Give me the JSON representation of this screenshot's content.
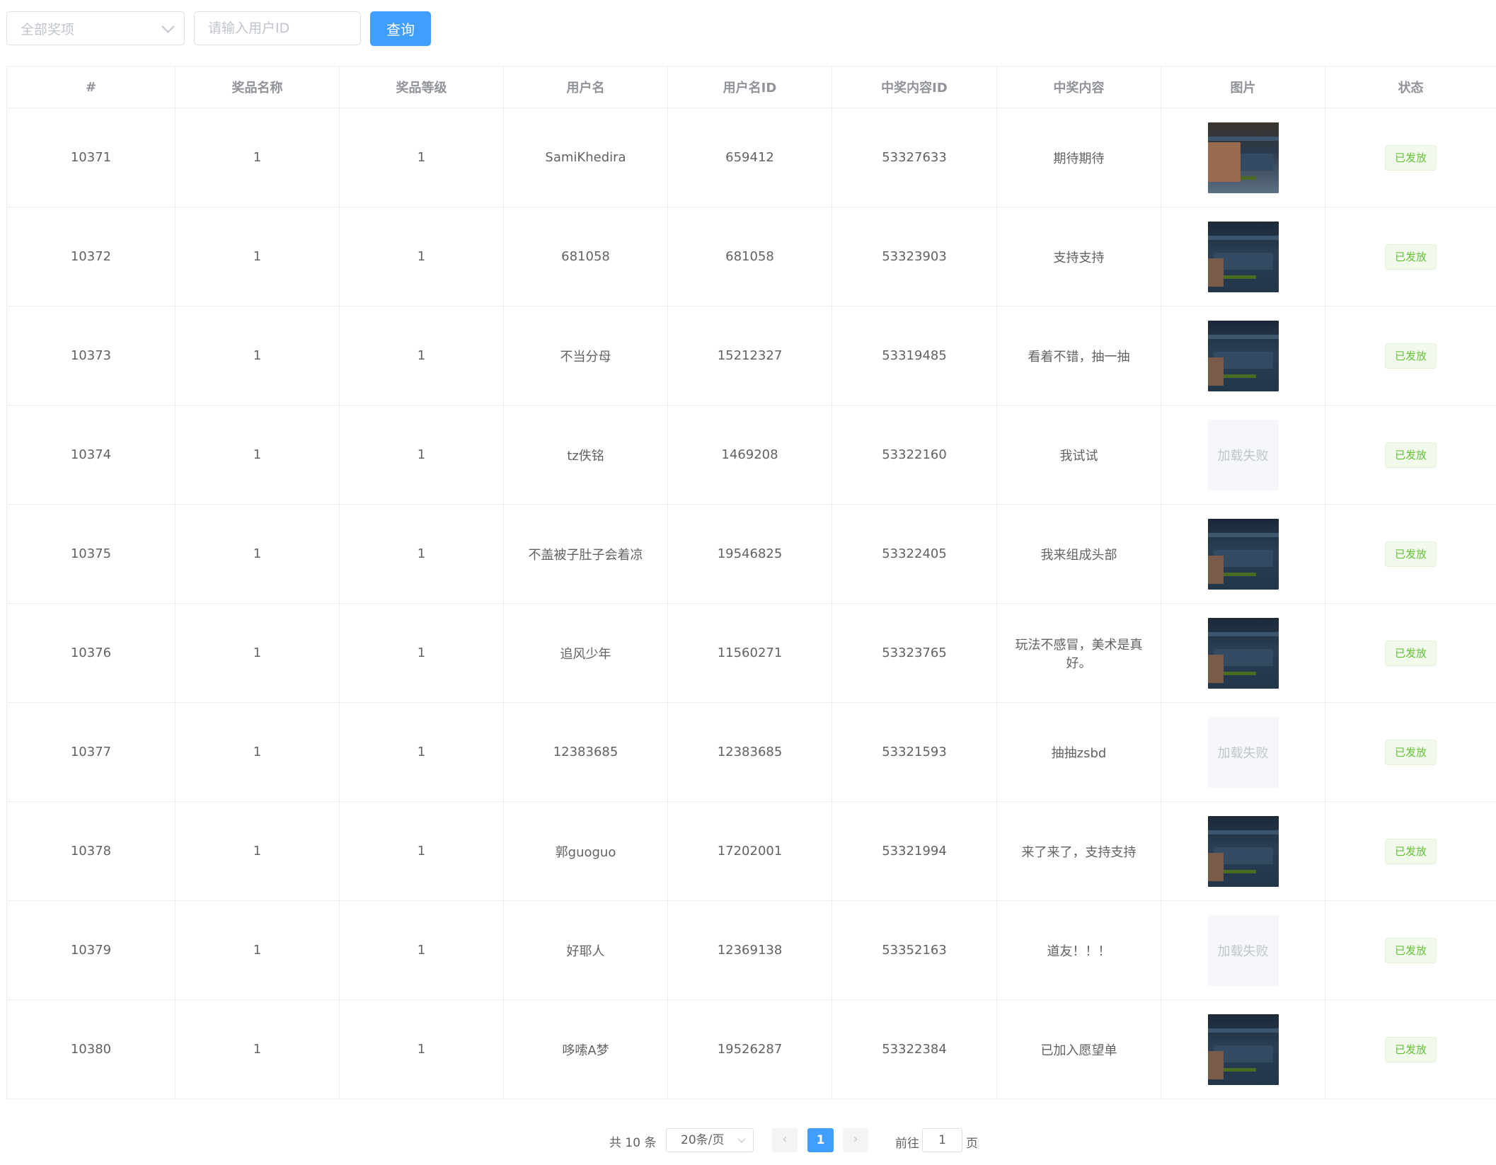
{
  "filters": {
    "prize_select_value": "全部奖项",
    "user_id_placeholder": "请输入用户ID",
    "query_button_label": "查询"
  },
  "table": {
    "columns": [
      "#",
      "奖品名称",
      "奖品等级",
      "用户名",
      "用户名ID",
      "中奖内容ID",
      "中奖内容",
      "图片",
      "状态"
    ],
    "image_fail_text": "加载失败",
    "rows": [
      {
        "id": "10371",
        "prize_name": "1",
        "prize_level": "1",
        "username": "SamiKhedira",
        "user_id": "659412",
        "content_id": "53327633",
        "content": "期待期待",
        "image_loaded": true,
        "status": "已发放"
      },
      {
        "id": "10372",
        "prize_name": "1",
        "prize_level": "1",
        "username": "681058",
        "user_id": "681058",
        "content_id": "53323903",
        "content": "支持支持",
        "image_loaded": true,
        "status": "已发放"
      },
      {
        "id": "10373",
        "prize_name": "1",
        "prize_level": "1",
        "username": "不当分母",
        "user_id": "15212327",
        "content_id": "53319485",
        "content": "看着不错，抽一抽",
        "image_loaded": true,
        "status": "已发放"
      },
      {
        "id": "10374",
        "prize_name": "1",
        "prize_level": "1",
        "username": "tz佚铭",
        "user_id": "1469208",
        "content_id": "53322160",
        "content": "我试试",
        "image_loaded": false,
        "status": "已发放"
      },
      {
        "id": "10375",
        "prize_name": "1",
        "prize_level": "1",
        "username": "不盖被子肚子会着凉",
        "user_id": "19546825",
        "content_id": "53322405",
        "content": "我来组成头部",
        "image_loaded": true,
        "status": "已发放"
      },
      {
        "id": "10376",
        "prize_name": "1",
        "prize_level": "1",
        "username": "追风少年",
        "user_id": "11560271",
        "content_id": "53323765",
        "content": "玩法不感冒，美术是真好。",
        "image_loaded": true,
        "status": "已发放"
      },
      {
        "id": "10377",
        "prize_name": "1",
        "prize_level": "1",
        "username": "12383685",
        "user_id": "12383685",
        "content_id": "53321593",
        "content": "抽抽zsbd",
        "image_loaded": false,
        "status": "已发放"
      },
      {
        "id": "10378",
        "prize_name": "1",
        "prize_level": "1",
        "username": "郭guoguo",
        "user_id": "17202001",
        "content_id": "53321994",
        "content": "来了来了，支持支持",
        "image_loaded": true,
        "status": "已发放"
      },
      {
        "id": "10379",
        "prize_name": "1",
        "prize_level": "1",
        "username": "好耶人",
        "user_id": "12369138",
        "content_id": "53352163",
        "content": "道友！！！",
        "image_loaded": false,
        "status": "已发放"
      },
      {
        "id": "10380",
        "prize_name": "1",
        "prize_level": "1",
        "username": "哆嗦A梦",
        "user_id": "19526287",
        "content_id": "53322384",
        "content": "已加入愿望单",
        "image_loaded": true,
        "status": "已发放"
      }
    ]
  },
  "pagination": {
    "total_text": "共 10 条",
    "page_size": "20条/页",
    "prev_icon": "chevron-left-icon",
    "next_icon": "chevron-right-icon",
    "current_page": "1",
    "goto_label": "前往",
    "goto_value": "1",
    "goto_unit": "页"
  },
  "colors": {
    "primary": "#409eff",
    "status_success_text": "#67c23a",
    "status_success_bg": "#f0f9eb",
    "border": "#ebeef5"
  }
}
